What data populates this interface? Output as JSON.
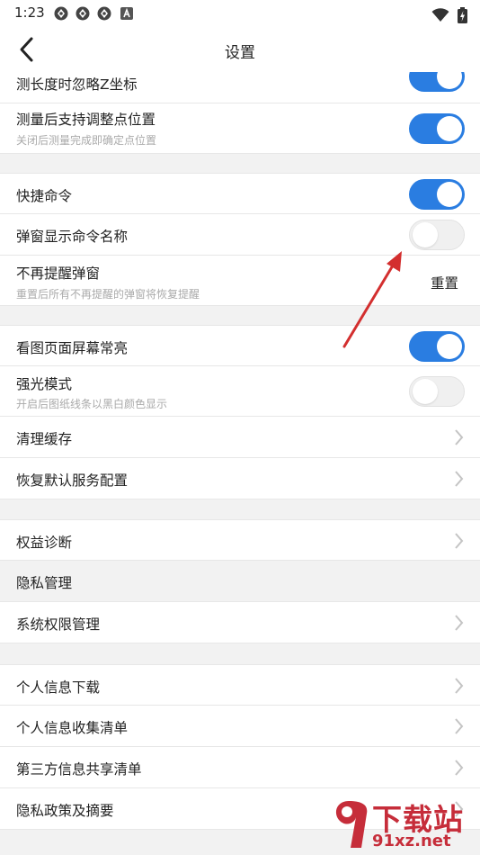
{
  "status_bar": {
    "time": "1:23",
    "notification_icons": [
      "app-icon",
      "app-icon",
      "app-icon",
      "a-badge-icon"
    ],
    "right_icons": [
      "wifi-icon",
      "battery-charging-icon"
    ]
  },
  "header": {
    "title": "设置",
    "back_icon": "chevron-left-icon"
  },
  "settings": {
    "measure_ignore_z": {
      "label": "测长度时忽略Z坐标",
      "on": true
    },
    "measure_adjust": {
      "label": "测量后支持调整点位置",
      "sublabel": "关闭后测量完成即确定点位置",
      "on": true
    },
    "shortcut_cmd": {
      "label": "快捷命令",
      "on": true
    },
    "popup_cmd_name": {
      "label": "弹窗显示命令名称",
      "on": false
    },
    "no_remind": {
      "label": "不再提醒弹窗",
      "sublabel": "重置后所有不再提醒的弹窗将恢复提醒",
      "action": "重置"
    },
    "screen_on": {
      "label": "看图页面屏幕常亮",
      "on": true
    },
    "high_light": {
      "label": "强光模式",
      "sublabel": "开启后图纸线条以黑白颜色显示",
      "on": false
    },
    "clear_cache": {
      "label": "清理缓存"
    },
    "restore_default": {
      "label": "恢复默认服务配置"
    },
    "rights_diag": {
      "label": "权益诊断"
    },
    "privacy_section": {
      "label": "隐私管理"
    },
    "system_perm": {
      "label": "系统权限管理"
    },
    "personal_download": {
      "label": "个人信息下载"
    },
    "personal_collect": {
      "label": "个人信息收集清单"
    },
    "third_party": {
      "label": "第三方信息共享清单"
    },
    "privacy_policy": {
      "label": "隐私政策及摘要"
    }
  },
  "colors": {
    "accent": "#2a7de1",
    "toggle_off": "#f0f0f0",
    "annotation_arrow": "#d32f2f",
    "watermark": "#c62d3a"
  },
  "watermark": {
    "line1": "下载站",
    "line2": "91xz.net"
  }
}
